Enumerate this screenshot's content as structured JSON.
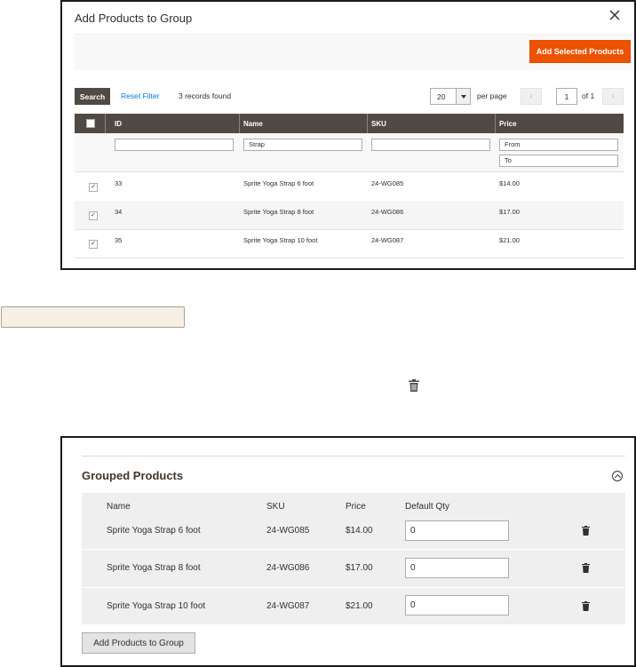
{
  "modal": {
    "title": "Add Products to Group",
    "add_selected_label": "Add Selected Products",
    "search_label": "Search",
    "reset_filter_label": "Reset Filter",
    "records_found": "3 records found",
    "per_page_value": "20",
    "per_page_label": "per page",
    "page_number": "1",
    "page_of": "of 1",
    "columns": [
      "ID",
      "Name",
      "SKU",
      "Price"
    ],
    "filters": {
      "id": "",
      "name": "Strap",
      "sku": "",
      "price_from_placeholder": "From",
      "price_to_placeholder": "To"
    },
    "rows": [
      {
        "checked": true,
        "id": "33",
        "name": "Sprite Yoga Strap 6 foot",
        "sku": "24-WG085",
        "price": "$14.00"
      },
      {
        "checked": true,
        "id": "34",
        "name": "Sprite Yoga Strap 8 foot",
        "sku": "24-WG086",
        "price": "$17.00"
      },
      {
        "checked": true,
        "id": "35",
        "name": "Sprite Yoga Strap 10 foot",
        "sku": "24-WG087",
        "price": "$21.00"
      }
    ],
    "colors": {
      "accent": "#eb5202",
      "header_bg": "#514943",
      "link": "#007bdb"
    }
  },
  "middle": {
    "button_label": "",
    "trash_icon": "trash-icon"
  },
  "panel": {
    "title": "Grouped Products",
    "columns": [
      "Name",
      "SKU",
      "Price",
      "Default Qty"
    ],
    "rows": [
      {
        "name": "Sprite Yoga Strap 6 foot",
        "sku": "24-WG085",
        "price": "$14.00",
        "qty": "0"
      },
      {
        "name": "Sprite Yoga Strap 8 foot",
        "sku": "24-WG086",
        "price": "$17.00",
        "qty": "0"
      },
      {
        "name": "Sprite Yoga Strap 10 foot",
        "sku": "24-WG087",
        "price": "$21.00",
        "qty": "0"
      }
    ],
    "add_button_label": "Add Products to Group"
  }
}
